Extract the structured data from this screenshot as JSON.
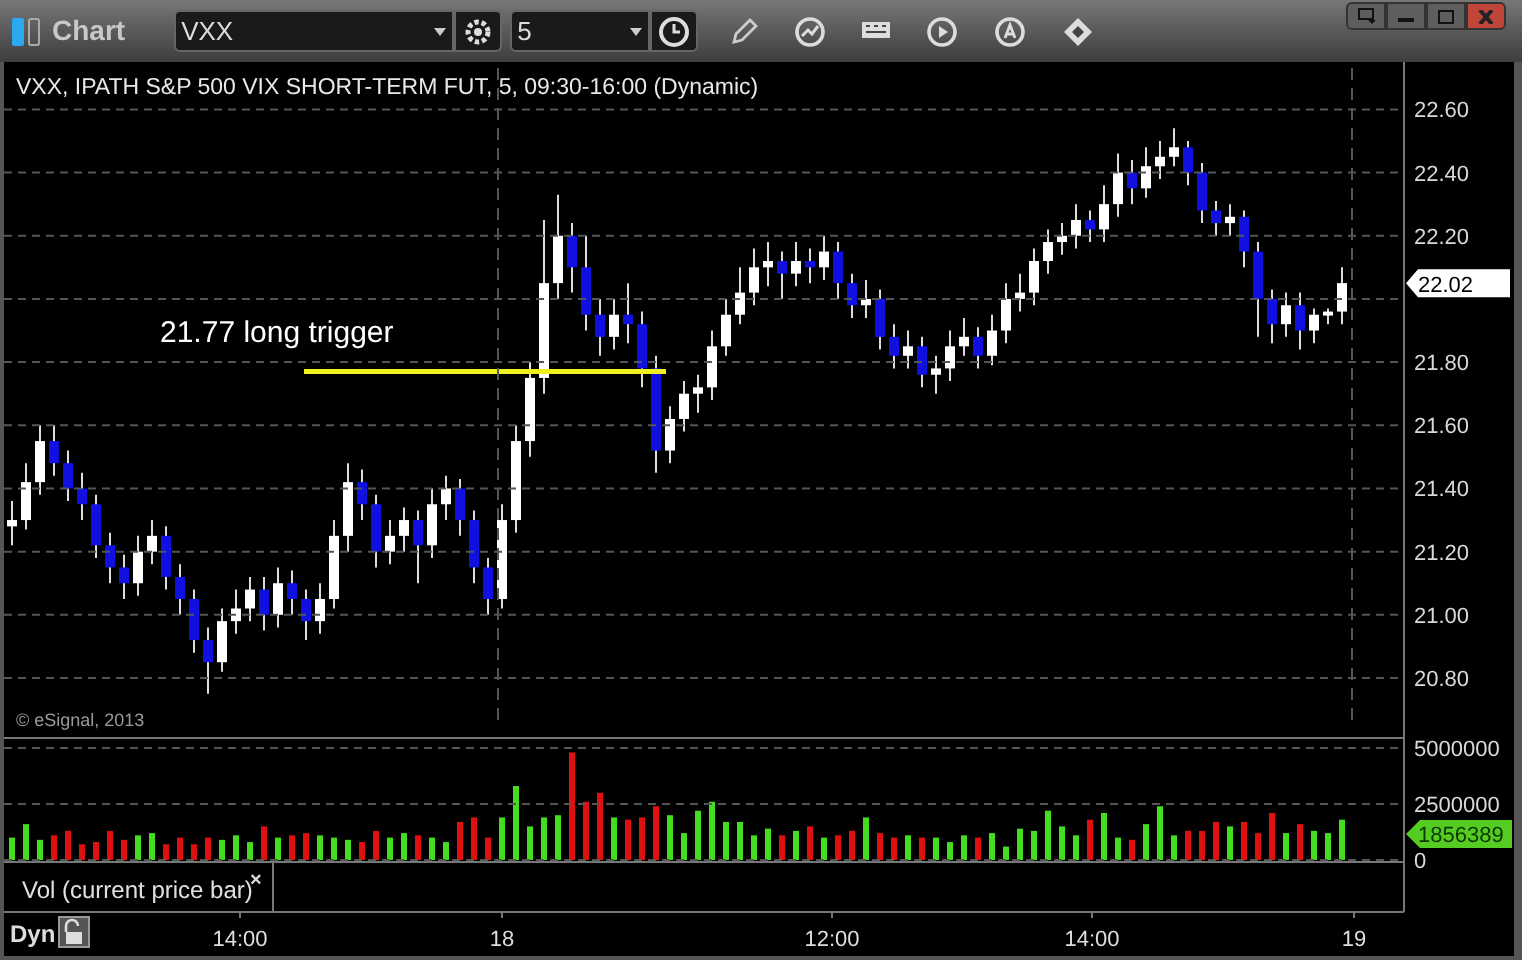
{
  "window": {
    "title": "Chart"
  },
  "toolbar": {
    "symbol": "VXX",
    "interval": "5"
  },
  "chart": {
    "title": "VXX, IPATH S&P 500 VIX SHORT-TERM FUT, 5, 09:30-16:00 (Dynamic)",
    "copyright": "© eSignal, 2013",
    "annotation": "21.77 long trigger",
    "last_price": "22.02",
    "chart_data": {
      "type": "candlestick",
      "ylim": [
        20.8,
        22.75
      ],
      "yticks": [
        {
          "value": 22.6,
          "label": "22.60"
        },
        {
          "value": 22.4,
          "label": "22.40"
        },
        {
          "value": 22.2,
          "label": "22.20"
        },
        {
          "value": 21.8,
          "label": "21.80"
        },
        {
          "value": 21.6,
          "label": "21.60"
        },
        {
          "value": 21.4,
          "label": "21.40"
        },
        {
          "value": 21.2,
          "label": "21.20"
        },
        {
          "value": 21.0,
          "label": "21.00"
        },
        {
          "value": 20.8,
          "label": "20.80"
        }
      ],
      "ohlc": [
        [
          21.28,
          21.36,
          21.22,
          21.3
        ],
        [
          21.3,
          21.48,
          21.27,
          21.42
        ],
        [
          21.42,
          21.6,
          21.38,
          21.55
        ],
        [
          21.55,
          21.6,
          21.44,
          21.48
        ],
        [
          21.48,
          21.52,
          21.36,
          21.4
        ],
        [
          21.4,
          21.45,
          21.3,
          21.35
        ],
        [
          21.35,
          21.38,
          21.18,
          21.22
        ],
        [
          21.22,
          21.26,
          21.1,
          21.15
        ],
        [
          21.15,
          21.19,
          21.05,
          21.1
        ],
        [
          21.1,
          21.25,
          21.06,
          21.2
        ],
        [
          21.2,
          21.3,
          21.16,
          21.25
        ],
        [
          21.25,
          21.28,
          21.08,
          21.12
        ],
        [
          21.12,
          21.16,
          21.0,
          21.05
        ],
        [
          21.05,
          21.08,
          20.88,
          20.92
        ],
        [
          20.92,
          20.96,
          20.75,
          20.85
        ],
        [
          20.85,
          21.02,
          20.82,
          20.98
        ],
        [
          20.98,
          21.08,
          20.94,
          21.02
        ],
        [
          21.02,
          21.12,
          20.98,
          21.08
        ],
        [
          21.08,
          21.12,
          20.95,
          21.0
        ],
        [
          21.0,
          21.15,
          20.96,
          21.1
        ],
        [
          21.1,
          21.14,
          21.0,
          21.05
        ],
        [
          21.05,
          21.08,
          20.92,
          20.98
        ],
        [
          20.98,
          21.1,
          20.94,
          21.05
        ],
        [
          21.05,
          21.3,
          21.02,
          21.25
        ],
        [
          21.25,
          21.48,
          21.2,
          21.42
        ],
        [
          21.42,
          21.46,
          21.3,
          21.35
        ],
        [
          21.35,
          21.38,
          21.15,
          21.2
        ],
        [
          21.2,
          21.3,
          21.16,
          21.25
        ],
        [
          21.25,
          21.34,
          21.2,
          21.3
        ],
        [
          21.3,
          21.33,
          21.1,
          21.22
        ],
        [
          21.22,
          21.4,
          21.18,
          21.35
        ],
        [
          21.35,
          21.44,
          21.3,
          21.4
        ],
        [
          21.4,
          21.43,
          21.25,
          21.3
        ],
        [
          21.3,
          21.33,
          21.1,
          21.15
        ],
        [
          21.15,
          21.18,
          21.0,
          21.05
        ],
        [
          21.05,
          21.35,
          21.02,
          21.3
        ],
        [
          21.3,
          21.6,
          21.26,
          21.55
        ],
        [
          21.55,
          21.8,
          21.5,
          21.75
        ],
        [
          21.75,
          22.25,
          21.7,
          22.05
        ],
        [
          22.05,
          22.33,
          22.0,
          22.2
        ],
        [
          22.2,
          22.24,
          22.02,
          22.1
        ],
        [
          22.1,
          22.2,
          21.9,
          21.95
        ],
        [
          21.95,
          22.0,
          21.82,
          21.88
        ],
        [
          21.88,
          22.0,
          21.84,
          21.95
        ],
        [
          21.95,
          22.05,
          21.86,
          21.92
        ],
        [
          21.92,
          21.96,
          21.72,
          21.78
        ],
        [
          21.78,
          21.82,
          21.45,
          21.52
        ],
        [
          21.52,
          21.66,
          21.48,
          21.62
        ],
        [
          21.62,
          21.74,
          21.58,
          21.7
        ],
        [
          21.7,
          21.76,
          21.64,
          21.72
        ],
        [
          21.72,
          21.9,
          21.68,
          21.85
        ],
        [
          21.85,
          22.0,
          21.82,
          21.95
        ],
        [
          21.95,
          22.1,
          21.92,
          22.02
        ],
        [
          22.02,
          22.16,
          21.98,
          22.1
        ],
        [
          22.1,
          22.18,
          22.04,
          22.12
        ],
        [
          22.12,
          22.15,
          22.0,
          22.08
        ],
        [
          22.08,
          22.18,
          22.04,
          22.12
        ],
        [
          22.12,
          22.16,
          22.05,
          22.1
        ],
        [
          22.1,
          22.2,
          22.06,
          22.15
        ],
        [
          22.15,
          22.18,
          22.0,
          22.05
        ],
        [
          22.05,
          22.08,
          21.94,
          21.98
        ],
        [
          21.98,
          22.06,
          21.94,
          22.0
        ],
        [
          22.0,
          22.03,
          21.84,
          21.88
        ],
        [
          21.88,
          21.92,
          21.78,
          21.82
        ],
        [
          21.82,
          21.9,
          21.78,
          21.85
        ],
        [
          21.85,
          21.88,
          21.72,
          21.76
        ],
        [
          21.76,
          21.82,
          21.7,
          21.78
        ],
        [
          21.78,
          21.9,
          21.74,
          21.85
        ],
        [
          21.85,
          21.94,
          21.82,
          21.88
        ],
        [
          21.88,
          21.91,
          21.78,
          21.82
        ],
        [
          21.82,
          21.95,
          21.79,
          21.9
        ],
        [
          21.9,
          22.05,
          21.86,
          22.0
        ],
        [
          22.0,
          22.08,
          21.96,
          22.02
        ],
        [
          22.02,
          22.16,
          21.98,
          22.12
        ],
        [
          22.12,
          22.22,
          22.08,
          22.18
        ],
        [
          22.18,
          22.24,
          22.14,
          22.2
        ],
        [
          22.2,
          22.3,
          22.16,
          22.25
        ],
        [
          22.25,
          22.28,
          22.18,
          22.22
        ],
        [
          22.22,
          22.36,
          22.18,
          22.3
        ],
        [
          22.3,
          22.46,
          22.26,
          22.4
        ],
        [
          22.4,
          22.44,
          22.3,
          22.35
        ],
        [
          22.35,
          22.48,
          22.32,
          22.42
        ],
        [
          22.42,
          22.5,
          22.38,
          22.45
        ],
        [
          22.45,
          22.54,
          22.42,
          22.48
        ],
        [
          22.48,
          22.5,
          22.36,
          22.4
        ],
        [
          22.4,
          22.43,
          22.24,
          22.28
        ],
        [
          22.28,
          22.31,
          22.2,
          22.24
        ],
        [
          22.24,
          22.3,
          22.2,
          22.26
        ],
        [
          22.26,
          22.28,
          22.1,
          22.15
        ],
        [
          22.15,
          22.18,
          21.88,
          22.0
        ],
        [
          22.0,
          22.03,
          21.86,
          21.92
        ],
        [
          21.92,
          22.02,
          21.88,
          21.98
        ],
        [
          21.98,
          22.02,
          21.84,
          21.9
        ],
        [
          21.9,
          21.97,
          21.86,
          21.95
        ],
        [
          21.95,
          21.97,
          21.92,
          21.96
        ],
        [
          21.96,
          22.1,
          21.92,
          22.05
        ]
      ]
    }
  },
  "volume": {
    "last_volume": "1856389",
    "label": "Vol (current price bar)",
    "close": "×",
    "chart_data": {
      "type": "bar",
      "ylim": [
        0,
        5000000
      ],
      "yticks": [
        {
          "value": 5000000,
          "label": "5000000"
        },
        {
          "value": 2500000,
          "label": "2500000"
        },
        {
          "value": 0,
          "label": "0"
        }
      ],
      "series": [
        {
          "values": [
            1000000,
            1600000,
            900000,
            1100000,
            1300000,
            700000,
            800000,
            1300000,
            900000,
            1100000,
            1200000,
            700000,
            1000000,
            700000,
            1000000,
            900000,
            1100000,
            800000,
            1500000,
            1000000,
            1100000,
            1200000,
            1100000,
            1000000,
            900000,
            800000,
            1300000,
            1000000,
            1200000,
            1100000,
            1000000,
            800000,
            1700000,
            1900000,
            1000000,
            1900000,
            3300000,
            1500000,
            1900000,
            2000000,
            4800000,
            2600000,
            3000000,
            1900000,
            1800000,
            1900000,
            2400000,
            2000000,
            1200000,
            2200000,
            2600000,
            1700000,
            1700000,
            1100000,
            1400000,
            1100000,
            1300000,
            1500000,
            1000000,
            1100000,
            1300000,
            1900000,
            1200000,
            1000000,
            1100000,
            1000000,
            1000000,
            800000,
            1100000,
            1000000,
            1200000,
            600000,
            1400000,
            1300000,
            2200000,
            1500000,
            1100000,
            1800000,
            2100000,
            1000000,
            900000,
            1600000,
            2400000,
            1100000,
            1300000,
            1300000,
            1700000,
            1500000,
            1700000,
            1200000,
            2100000,
            1200000,
            1600000,
            1300000,
            1200000,
            1800000
          ]
        }
      ]
    }
  },
  "time_axis": {
    "mode": "Dyn",
    "labels": [
      "14:00",
      "18",
      "12:00",
      "14:00",
      "19"
    ]
  }
}
